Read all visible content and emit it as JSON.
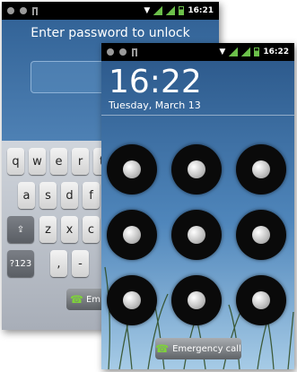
{
  "back_screen": {
    "status": {
      "time": "16:21"
    },
    "prompt": "Enter password to unlock",
    "keyboard": {
      "row1": [
        "q",
        "w",
        "e",
        "r",
        "t"
      ],
      "row2": [
        "a",
        "s",
        "d",
        "f"
      ],
      "row3": [
        "z",
        "x",
        "c"
      ],
      "shift_glyph": "⇪",
      "symbols_label": "?123",
      "comma": ",",
      "dash": "-"
    },
    "emergency_label": "Em"
  },
  "front_screen": {
    "status": {
      "time": "16:22"
    },
    "clock": "16:22",
    "date": "Tuesday, March 13",
    "emergency_label": "Emergency call",
    "pattern_grid": {
      "rows": 3,
      "cols": 3
    }
  },
  "icons": {
    "phone": "☎",
    "wifi": "▼"
  }
}
